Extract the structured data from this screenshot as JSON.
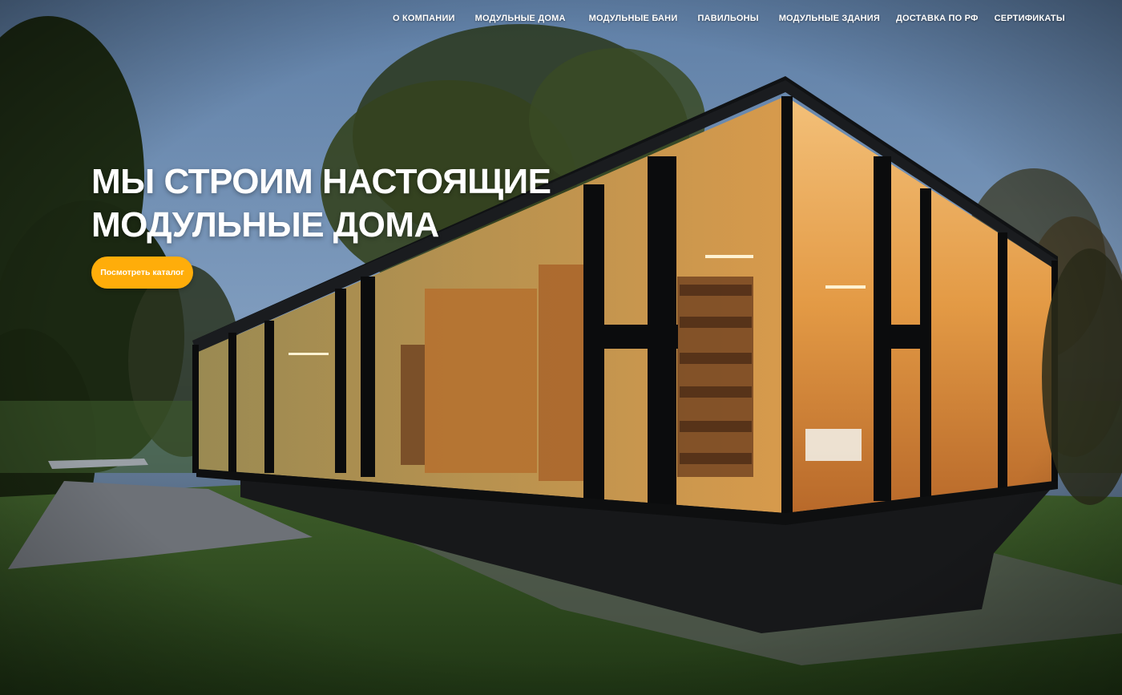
{
  "nav": {
    "items": [
      {
        "label": "О компании"
      },
      {
        "label": "Модульные дома"
      },
      {
        "label": "Модульные бани"
      },
      {
        "label": "Павильоны"
      },
      {
        "label": "Модульные здания"
      },
      {
        "label": "Доставка по РФ"
      },
      {
        "label": "Сертификаты"
      }
    ]
  },
  "hero": {
    "headline_line1": "Мы строим настоящие",
    "headline_line2": "модульные дома",
    "cta_label": "Посмотреть каталог",
    "image_subject": "modular glass house at dusk"
  },
  "colors": {
    "cta": "#ffad0a",
    "text": "#ffffff",
    "interior_glow": "#e8a24a"
  }
}
